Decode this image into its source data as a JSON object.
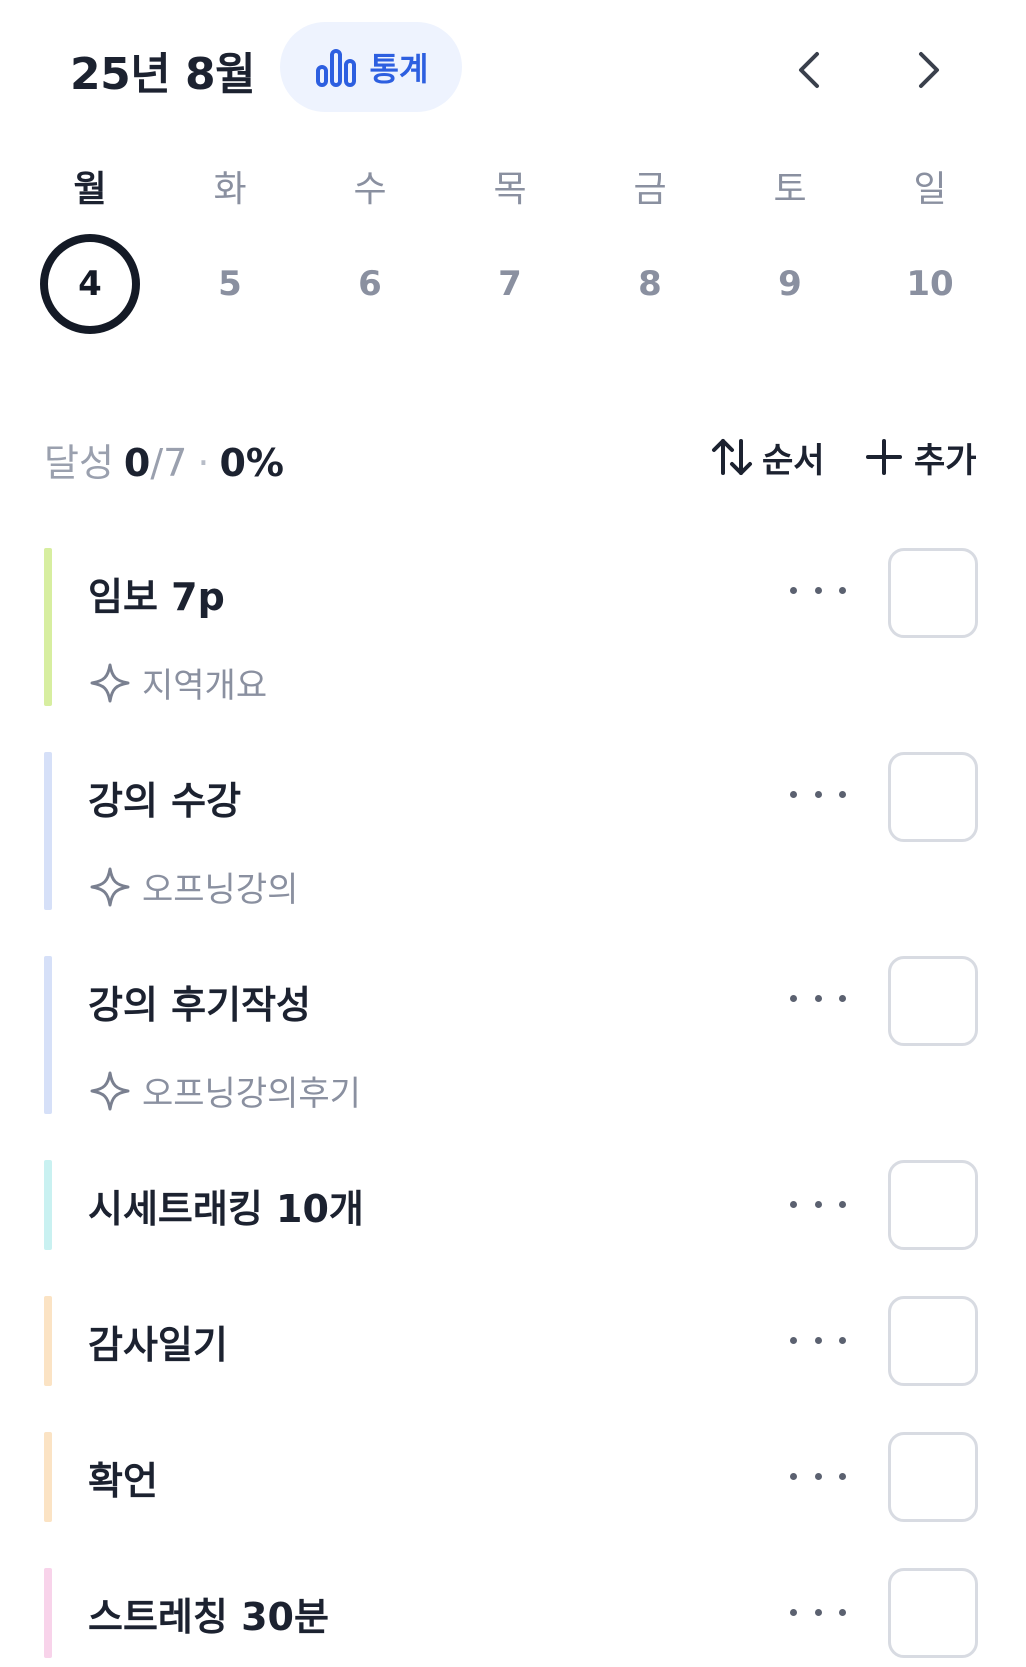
{
  "header": {
    "month_title": "25년 8월",
    "stats_label": "통계",
    "accent_color": "#2d5fe0"
  },
  "week": {
    "days": [
      {
        "label": "월",
        "date": "4",
        "selected": true
      },
      {
        "label": "화",
        "date": "5",
        "selected": false
      },
      {
        "label": "수",
        "date": "6",
        "selected": false
      },
      {
        "label": "목",
        "date": "7",
        "selected": false
      },
      {
        "label": "금",
        "date": "8",
        "selected": false
      },
      {
        "label": "토",
        "date": "9",
        "selected": false
      },
      {
        "label": "일",
        "date": "10",
        "selected": false
      }
    ]
  },
  "progress": {
    "label": "달성",
    "done": "0",
    "total": "/7",
    "separator": "·",
    "percent": "0%"
  },
  "actions": {
    "sort_label": "순서",
    "add_label": "추가"
  },
  "habits": [
    {
      "name": "임보 7p",
      "sub": "지역개요",
      "color": "#d7eea0",
      "icon": "sparkle-icon"
    },
    {
      "name": "강의 수강",
      "sub": "오프닝강의",
      "color": "#d6e0f8",
      "icon": "sparkle-icon"
    },
    {
      "name": "강의 후기작성",
      "sub": "오프닝강의후기",
      "color": "#d6e0f8",
      "icon": "sparkle-icon"
    },
    {
      "name": "시세트래킹 10개",
      "sub": "",
      "color": "#c9f1f1",
      "icon": ""
    },
    {
      "name": "감사일기",
      "sub": "",
      "color": "#fbe3c4",
      "icon": ""
    },
    {
      "name": "확언",
      "sub": "",
      "color": "#fbe3c4",
      "icon": ""
    },
    {
      "name": "스트레칭 30분",
      "sub": "",
      "color": "#f8d3ea",
      "icon": ""
    }
  ]
}
